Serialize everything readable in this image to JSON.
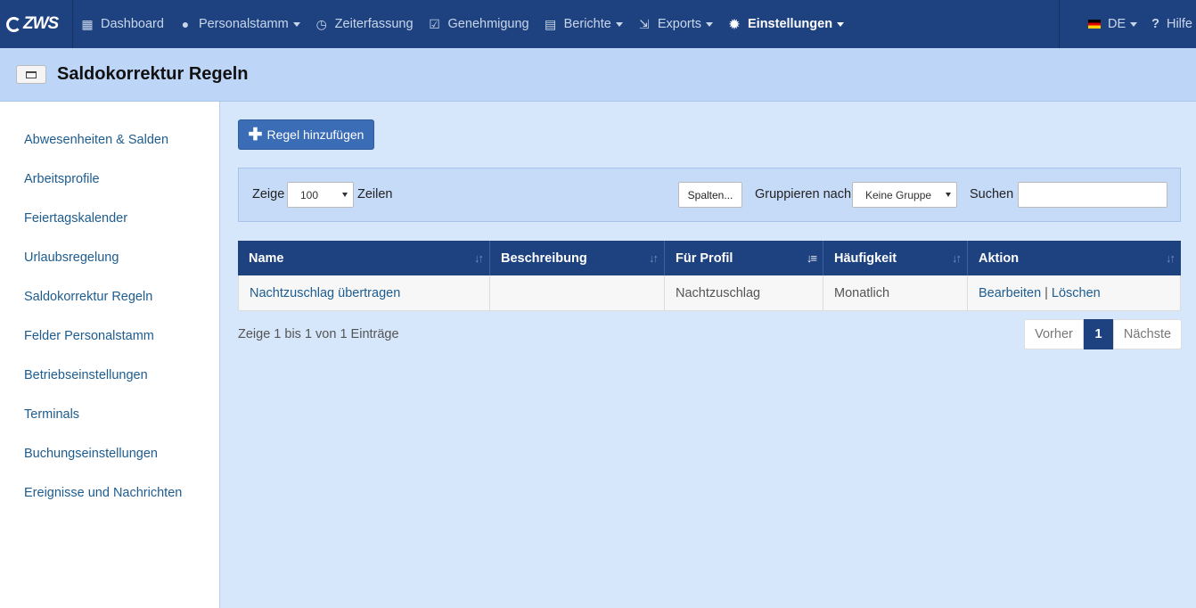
{
  "app": {
    "logo": "ZWS"
  },
  "nav": {
    "items": [
      {
        "label": "Dashboard",
        "icon": "grid-icon"
      },
      {
        "label": "Personalstamm",
        "icon": "user-icon"
      },
      {
        "label": "Zeiterfassung",
        "icon": "clock-icon"
      },
      {
        "label": "Genehmigung",
        "icon": "check-square-icon"
      },
      {
        "label": "Berichte",
        "icon": "print-icon"
      },
      {
        "label": "Exports",
        "icon": "export-icon"
      },
      {
        "label": "Einstellungen",
        "icon": "gear-icon"
      }
    ],
    "language": "DE",
    "help": "Hilfe"
  },
  "page": {
    "title": "Saldokorrektur Regeln"
  },
  "sidebar": {
    "items": [
      "Abwesenheiten & Salden",
      "Arbeitsprofile",
      "Feiertagskalender",
      "Urlaubsregelung",
      "Saldokorrektur Regeln",
      "Felder Personalstamm",
      "Betriebseinstellungen",
      "Terminals",
      "Buchungseinstellungen",
      "Ereignisse und Nachrichten"
    ]
  },
  "toolbar": {
    "add_label": "Regel hinzufügen"
  },
  "filters": {
    "show_label": "Zeige",
    "page_size": "100",
    "rows_label": "Zeilen",
    "columns_button": "Spalten...",
    "group_label": "Gruppieren nach",
    "group_value": "Keine Gruppe",
    "search_label": "Suchen",
    "search_value": ""
  },
  "table": {
    "headers": [
      "Name",
      "Beschreibung",
      "Für Profil",
      "Häufigkeit",
      "Aktion"
    ],
    "rows": [
      {
        "name": "Nachtzuschlag übertragen",
        "beschreibung": "",
        "profil": "Nachtzuschlag",
        "haeufigkeit": "Monatlich",
        "edit": "Bearbeiten",
        "separator": "|",
        "delete": "Löschen"
      }
    ]
  },
  "footer": {
    "info": "Zeige 1 bis 1 von 1 Einträge",
    "prev": "Vorher",
    "current_page": "1",
    "next": "Nächste"
  },
  "colors": {
    "nav_bg": "#1e4280",
    "accent_button": "#3a6db5",
    "link": "#1d5c8f",
    "page_bg": "#d6e6fb"
  }
}
